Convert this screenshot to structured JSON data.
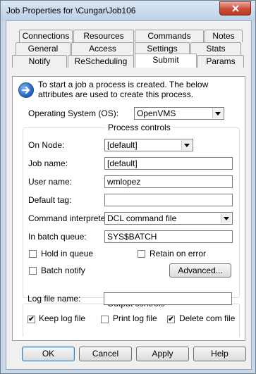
{
  "window": {
    "title": "Job Properties for \\Cungar\\Job106"
  },
  "tabs": {
    "row1": [
      "Connections",
      "Resources",
      "Commands",
      "Notes"
    ],
    "row2": [
      "General",
      "Access",
      "Settings",
      "Stats"
    ],
    "row3": [
      "Notify",
      "ReScheduling",
      "Submit",
      "Params"
    ],
    "active": "Submit"
  },
  "info": {
    "text": "To start a job a process is created.  The below attributes are used to create this process."
  },
  "os": {
    "label": "Operating System (OS):",
    "value": "OpenVMS"
  },
  "process_controls": {
    "title": "Process controls",
    "on_node_label": "On Node:",
    "on_node_value": "[default]",
    "job_name_label": "Job name:",
    "job_name_value": "[default]",
    "user_name_label": "User name:",
    "user_name_value": "wmlopez",
    "default_tag_label": "Default tag:",
    "default_tag_value": "",
    "cmd_interp_label": "Command interpreter:",
    "cmd_interp_value": "DCL command file",
    "batch_queue_label": "In batch queue:",
    "batch_queue_value": "SYS$BATCH",
    "hold_in_queue": {
      "label": "Hold in queue",
      "checked": false
    },
    "retain_on_error": {
      "label": "Retain on error",
      "checked": false
    },
    "batch_notify": {
      "label": "Batch notify",
      "checked": false
    },
    "advanced_label": "Advanced..."
  },
  "output_controls": {
    "title": "Output controls",
    "log_file_label": "Log file name:",
    "log_file_value": "",
    "keep_log_file": {
      "label": "Keep log file",
      "checked": true
    },
    "print_log_file": {
      "label": "Print log file",
      "checked": false
    },
    "delete_com_file": {
      "label": "Delete com file",
      "checked": true
    }
  },
  "buttons": {
    "ok": "OK",
    "cancel": "Cancel",
    "apply": "Apply",
    "help": "Help"
  },
  "colors": {
    "accent": "#1d5fb8",
    "close": "#c94d35"
  }
}
